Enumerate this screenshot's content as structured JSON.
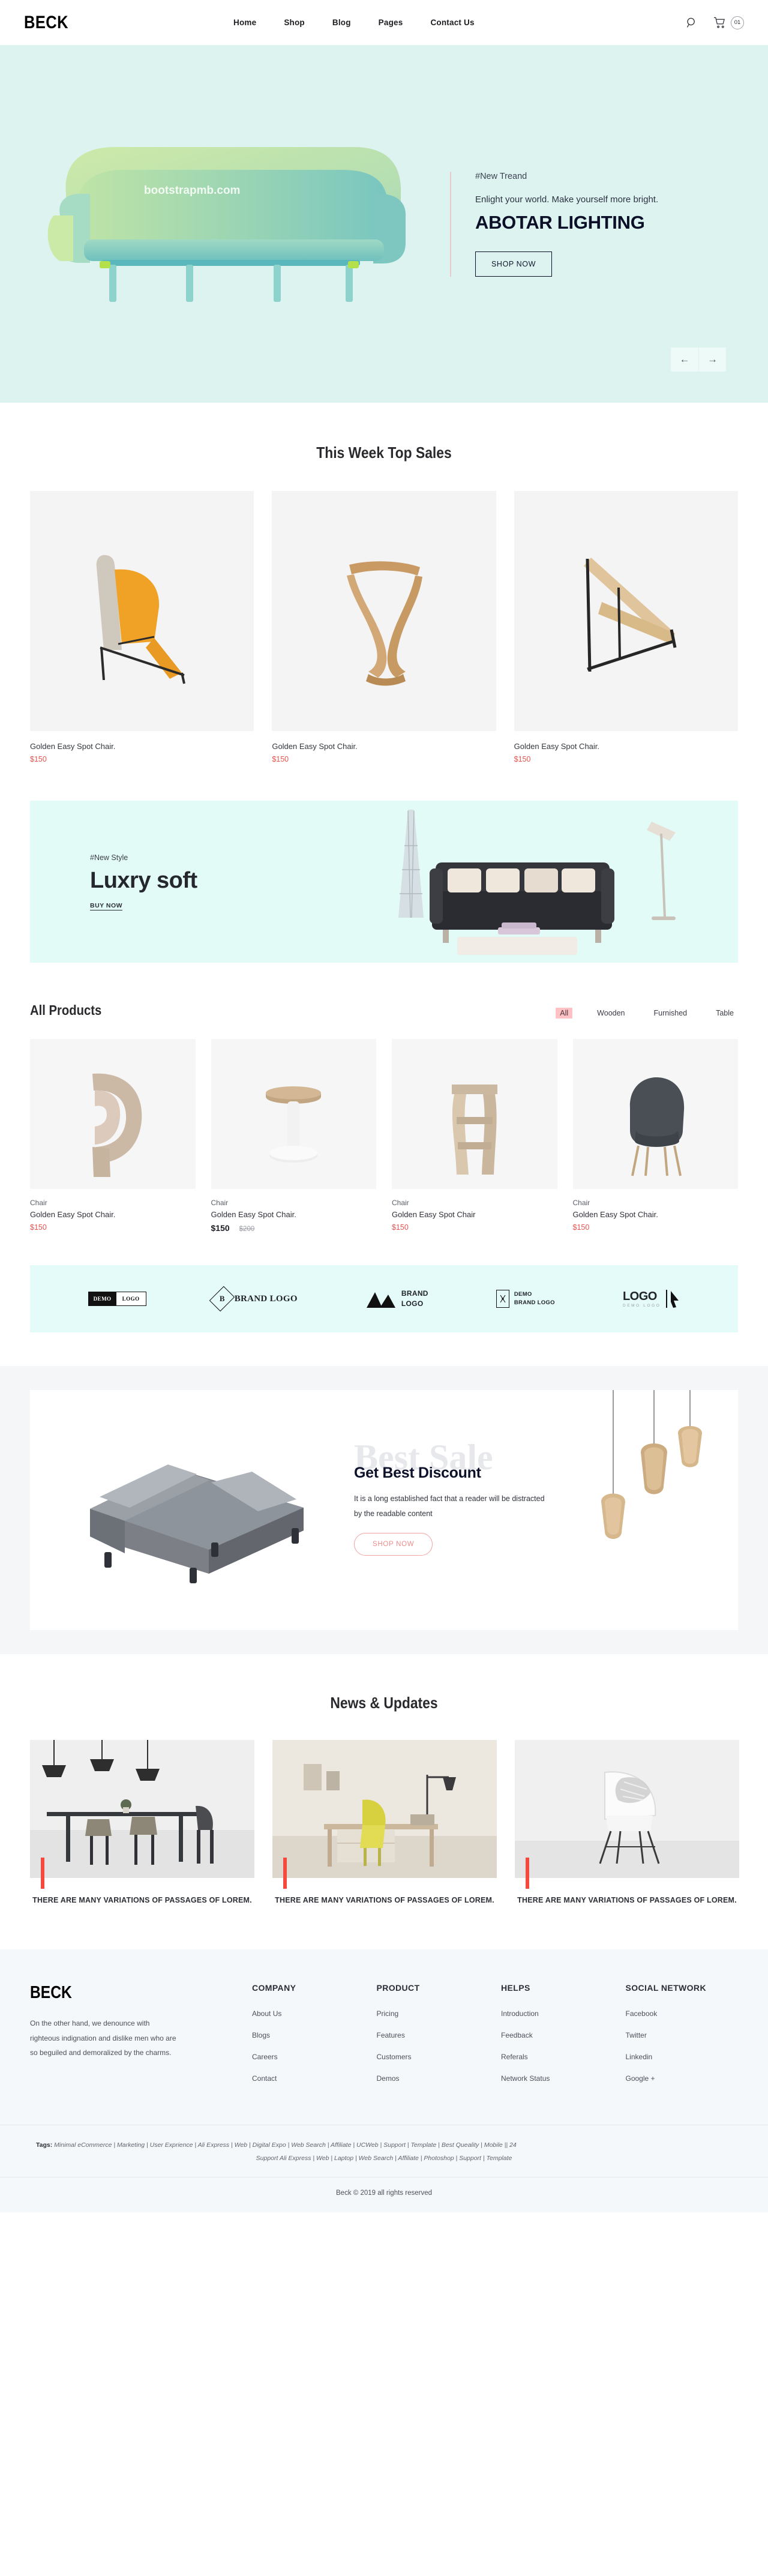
{
  "header": {
    "logo": "BECK",
    "nav": [
      {
        "label": "Home"
      },
      {
        "label": "Shop"
      },
      {
        "label": "Blog"
      },
      {
        "label": "Pages"
      },
      {
        "label": "Contact Us"
      }
    ],
    "search_icon": "search-icon",
    "cart_icon": "cart-icon",
    "cart_count": "01"
  },
  "hero": {
    "tag": "#New Treand",
    "subtitle": "Enlight your world. Make yourself more bright.",
    "title": "ABOTAR LIGHTING",
    "cta": "SHOP NOW",
    "watermark": "bootstrapmb.com",
    "prev_arrow": "←",
    "next_arrow": "→",
    "bg_color": "#dcf3f0"
  },
  "top_sales": {
    "title": "This Week Top Sales",
    "items": [
      {
        "name": "Golden Easy Spot Chair.",
        "price": "$150"
      },
      {
        "name": "Golden Easy Spot Chair.",
        "price": "$150"
      },
      {
        "name": "Golden Easy Spot Chair.",
        "price": "$150"
      }
    ]
  },
  "luxry_banner": {
    "tag": "#New Style",
    "title": "Luxry soft",
    "link": "BUY NOW",
    "bg_color": "#e3fbf7"
  },
  "all_products": {
    "title": "All Products",
    "filters": [
      {
        "label": "All",
        "active": true
      },
      {
        "label": "Wooden",
        "active": false
      },
      {
        "label": "Furnished",
        "active": false
      },
      {
        "label": "Table",
        "active": false
      }
    ],
    "items": [
      {
        "category": "Chair",
        "name": "Golden Easy Spot Chair.",
        "price": "$150",
        "old_price": "",
        "sale": false
      },
      {
        "category": "Chair",
        "name": "Golden Easy Spot Chair.",
        "price": "$150",
        "old_price": "$200",
        "sale": true
      },
      {
        "category": "Chair",
        "name": "Golden Easy Spot Chair",
        "price": "$150",
        "old_price": "",
        "sale": false
      },
      {
        "category": "Chair",
        "name": "Golden Easy Spot Chair.",
        "price": "$150",
        "old_price": "",
        "sale": false
      }
    ]
  },
  "brands": {
    "bg_color": "#e4fbf9",
    "items": [
      {
        "part_a": "DEMO",
        "part_b": "LOGO"
      },
      {
        "mark": "B",
        "text": "BRAND LOGO"
      },
      {
        "line1": "BRAND",
        "line2": "LOGO"
      },
      {
        "line1": "DEMO",
        "line2": "BRAND LOGO"
      },
      {
        "big": "LOGO",
        "sub": "DEMO LOGO"
      }
    ]
  },
  "discount": {
    "watermark": "Best Sale",
    "title": "Get Best Discount",
    "body": "It is a long established fact that a reader will be distracted by the readable content",
    "cta": "SHOP NOW",
    "cta_color": "#f08b8b"
  },
  "news": {
    "title": "News & Updates",
    "accent_color": "#f3493f",
    "items": [
      {
        "title": "THERE ARE MANY VARIATIONS OF PASSAGES OF LOREM."
      },
      {
        "title": "THERE ARE MANY VARIATIONS OF PASSAGES OF LOREM."
      },
      {
        "title": "THERE ARE MANY VARIATIONS OF PASSAGES OF LOREM."
      }
    ]
  },
  "footer": {
    "logo": "BECK",
    "about": "On the other hand, we denounce with righteous indignation and dislike men who are so beguiled and demoralized by the charms.",
    "columns": [
      {
        "title": "COMPANY",
        "links": [
          "About Us",
          "Blogs",
          "Careers",
          "Contact"
        ]
      },
      {
        "title": "PRODUCT",
        "links": [
          "Pricing",
          "Features",
          "Customers",
          "Demos"
        ]
      },
      {
        "title": "HELPS",
        "links": [
          "Introduction",
          "Feedback",
          "Referals",
          "Network Status"
        ]
      },
      {
        "title": "SOCIAL NETWORK",
        "links": [
          "Facebook",
          "Twitter",
          "Linkedin",
          "Google +"
        ]
      }
    ],
    "tags_label": "Tags:",
    "tags_line1": "Minimal eCommerce | Marketing | User Exprience | Ali Express | Web | Digital Expo | Web Search | Affiliate | UCWeb | Support | Template | Best Queality | Mobile || 24",
    "tags_line2": "Support   Ali Express | Web | Laptop | Web Search | Affiliate | Photoshop | Support | Template",
    "copyright": "Beck © 2019 all rights reserved"
  }
}
